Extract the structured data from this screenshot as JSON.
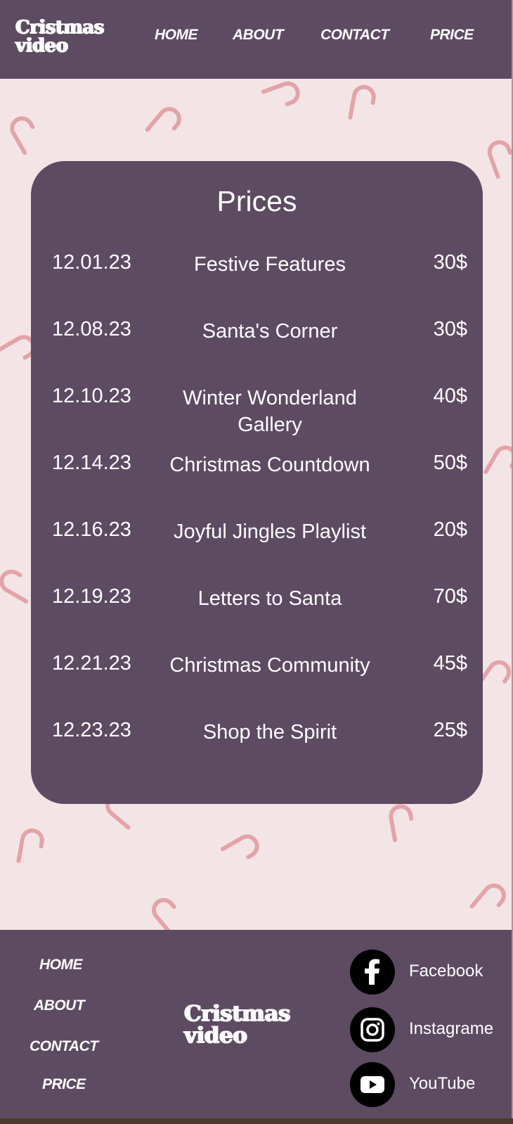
{
  "brand": {
    "line1": "Cristmas",
    "line2": "video"
  },
  "nav": [
    "HOME",
    "ABOUT",
    "CONTACT",
    "PRICE"
  ],
  "prices": {
    "title": "Prices",
    "rows": [
      {
        "date": "12.01.23",
        "name": "Festive Features",
        "price": "30$"
      },
      {
        "date": "12.08.23",
        "name": "Santa's Corner",
        "price": "30$"
      },
      {
        "date": "12.10.23",
        "name": "Winter Wonderland Gallery",
        "price": "40$"
      },
      {
        "date": "12.14.23",
        "name": "Christmas Countdown",
        "price": "50$"
      },
      {
        "date": "12.16.23",
        "name": "Joyful Jingles Playlist",
        "price": "20$"
      },
      {
        "date": "12.19.23",
        "name": "Letters to Santa",
        "price": "70$"
      },
      {
        "date": "12.21.23",
        "name": "Christmas Community",
        "price": "45$"
      },
      {
        "date": "12.23.23",
        "name": "Shop the Spirit",
        "price": "25$"
      }
    ]
  },
  "footer": {
    "nav": [
      "HOME",
      "ABOUT",
      "CONTACT",
      "PRICE"
    ],
    "social": [
      {
        "label": "Facebook",
        "icon": "facebook-icon"
      },
      {
        "label": "Instagrame",
        "icon": "instagram-icon"
      },
      {
        "label": "YouTube",
        "icon": "youtube-icon"
      }
    ]
  },
  "colors": {
    "primary": "#5d4b62",
    "background": "#f3e5e6",
    "accent": "#e3a3a8"
  }
}
